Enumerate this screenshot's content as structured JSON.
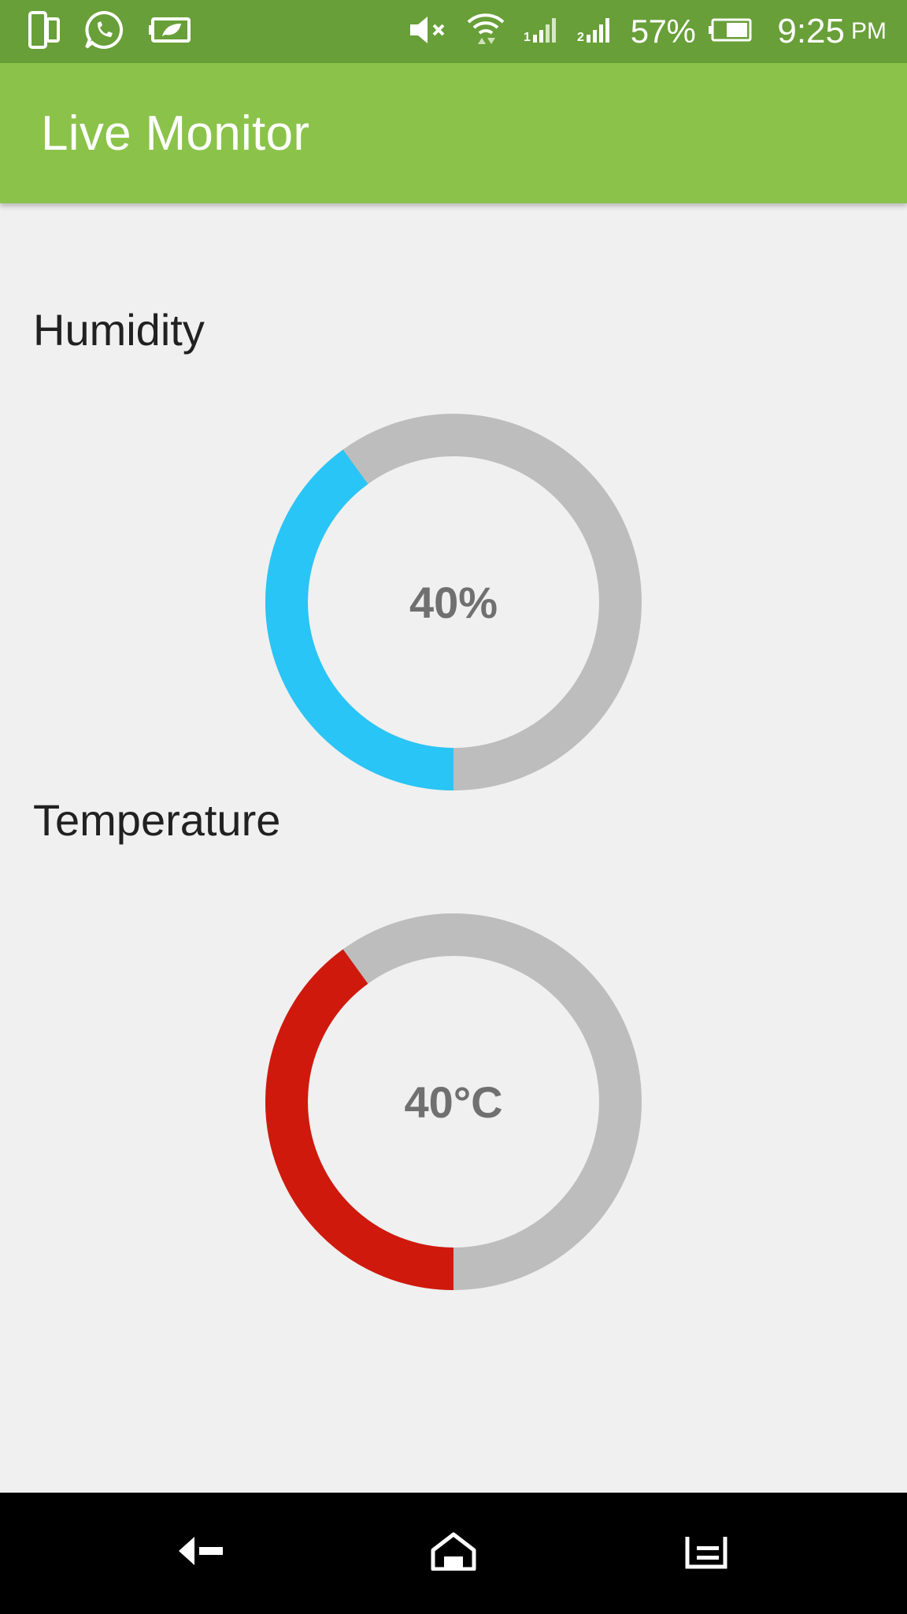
{
  "status_bar": {
    "left_icons": [
      "device-icon",
      "whatsapp-icon",
      "battery-saver-icon"
    ],
    "right_icons": [
      "mute-icon",
      "wifi-icon",
      "signal-1x-icon",
      "signal-2-icon"
    ],
    "battery_percent": "57%",
    "time": "9:25",
    "ampm": "PM",
    "bar_color": "#689f38"
  },
  "app_bar": {
    "title": "Live Monitor",
    "color": "#8bc34a"
  },
  "humidity": {
    "label": "Humidity",
    "value_text": "40%",
    "fraction": 0.4,
    "color": "#29c5f6"
  },
  "temperature": {
    "label": "Temperature",
    "value_text": "40°C",
    "fraction": 0.4,
    "color": "#d0190d"
  },
  "gauge_track_color": "#bdbdbd",
  "nav_bar": {
    "buttons": [
      "back-icon",
      "home-icon",
      "recents-icon"
    ]
  }
}
